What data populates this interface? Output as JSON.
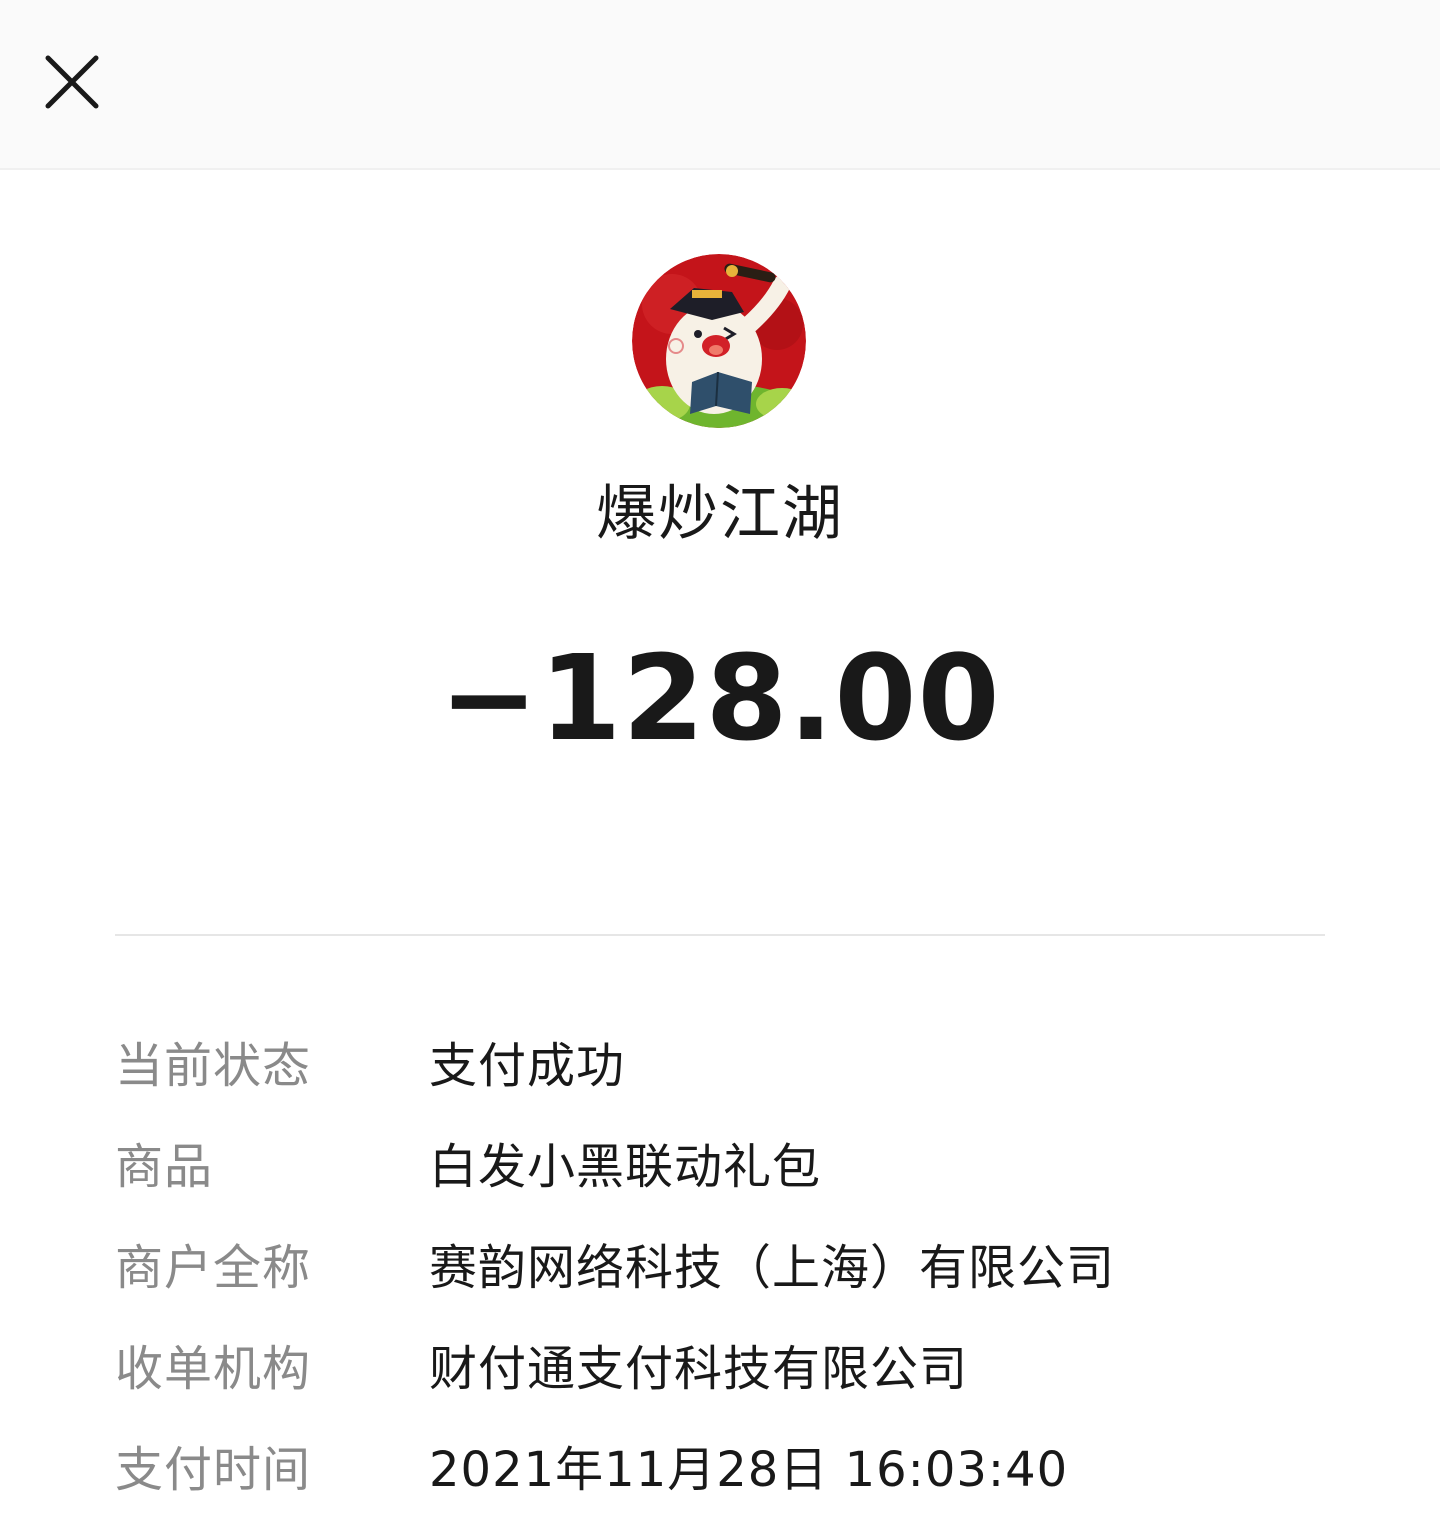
{
  "header": {
    "close_icon": "close-icon"
  },
  "merchant": {
    "avatar_icon": "game-character-avatar",
    "name": "爆炒江湖"
  },
  "amount": "−128.00",
  "details": [
    {
      "label": "当前状态",
      "value": "支付成功"
    },
    {
      "label": "商品",
      "value": "白发小黑联动礼包"
    },
    {
      "label": "商户全称",
      "value": "赛韵网络科技（上海）有限公司"
    },
    {
      "label": "收单机构",
      "value": "财付通支付科技有限公司"
    },
    {
      "label": "支付时间",
      "value": "2021年11月28日 16:03:40"
    }
  ],
  "colors": {
    "background": "#ffffff",
    "topbar": "#fafafa",
    "label": "#8a8a8a",
    "value": "#191919",
    "avatar_red": "#c4141a"
  }
}
